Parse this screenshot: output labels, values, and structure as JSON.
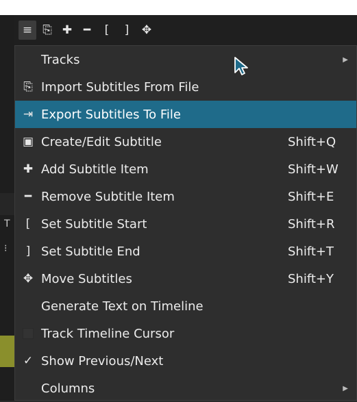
{
  "background": {
    "left_glyphs": [
      "T",
      "⁝"
    ],
    "accent_olive": "#8a8f2c"
  },
  "toolbar": {
    "buttons": [
      {
        "icon": "hamburger-menu-icon",
        "glyph": "≡"
      },
      {
        "icon": "import-icon",
        "glyph": "⎘"
      },
      {
        "icon": "plus-icon",
        "glyph": "✚"
      },
      {
        "icon": "minus-icon",
        "glyph": "━"
      },
      {
        "icon": "bracket-left-icon",
        "glyph": "["
      },
      {
        "icon": "bracket-right-icon",
        "glyph": "]"
      },
      {
        "icon": "move-icon",
        "glyph": "✥"
      }
    ]
  },
  "menu": {
    "highlight_color": "#1f6b8a",
    "items": [
      {
        "label": "Tracks",
        "shortcut": "",
        "submenu": true
      },
      {
        "label": "Import Subtitles From File",
        "shortcut": "",
        "icon": "import-file-icon",
        "glyph": "⎘"
      },
      {
        "label": "Export Subtitles To File",
        "shortcut": "",
        "icon": "export-file-icon",
        "glyph": "⇥"
      },
      {
        "label": "Create/Edit Subtitle",
        "shortcut": "Shift+Q",
        "icon": "edit-subtitle-icon",
        "glyph": "▣"
      },
      {
        "label": "Add Subtitle Item",
        "shortcut": "Shift+W",
        "icon": "plus-icon",
        "glyph": "✚"
      },
      {
        "label": "Remove Subtitle Item",
        "shortcut": "Shift+E",
        "icon": "minus-icon",
        "glyph": "━"
      },
      {
        "label": "Set Subtitle Start",
        "shortcut": "Shift+R",
        "icon": "bracket-left-icon",
        "glyph": "["
      },
      {
        "label": "Set Subtitle End",
        "shortcut": "Shift+T",
        "icon": "bracket-right-icon",
        "glyph": "]"
      },
      {
        "label": "Move Subtitles",
        "shortcut": "Shift+Y",
        "icon": "move-icon",
        "glyph": "✥"
      },
      {
        "label": "Generate Text on Timeline",
        "shortcut": ""
      },
      {
        "label": "Track Timeline Cursor",
        "shortcut": "",
        "checkbox": false
      },
      {
        "label": "Show Previous/Next",
        "shortcut": "",
        "checked": true,
        "glyph": "✓"
      },
      {
        "label": "Columns",
        "shortcut": "",
        "submenu": true
      }
    ]
  }
}
